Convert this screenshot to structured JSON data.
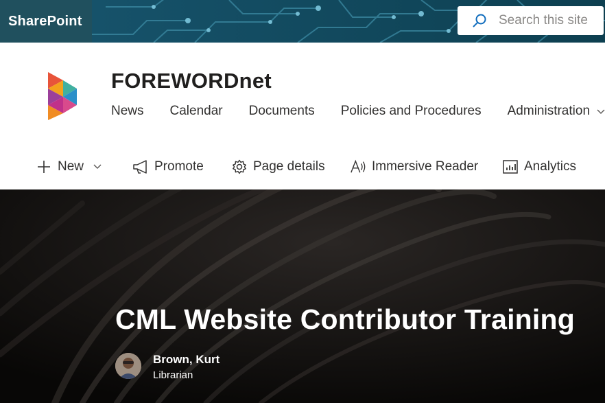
{
  "suitebar": {
    "app_name": "SharePoint",
    "search_placeholder": "Search this site",
    "colors": {
      "bar": "#0f4a5c",
      "brand_bg": "#20505e"
    }
  },
  "site": {
    "title": "FOREWORDnet",
    "logo_icon": "forewordnet-logo-icon",
    "nav": [
      "News",
      "Calendar",
      "Documents",
      "Policies and Procedures",
      "Administration"
    ]
  },
  "commands": {
    "new": "New",
    "promote": "Promote",
    "page_details": "Page details",
    "immersive_reader": "Immersive Reader",
    "analytics": "Analytics"
  },
  "hero": {
    "title": "CML Website Contributor Training",
    "author_name": "Brown, Kurt",
    "author_role": "Librarian"
  }
}
